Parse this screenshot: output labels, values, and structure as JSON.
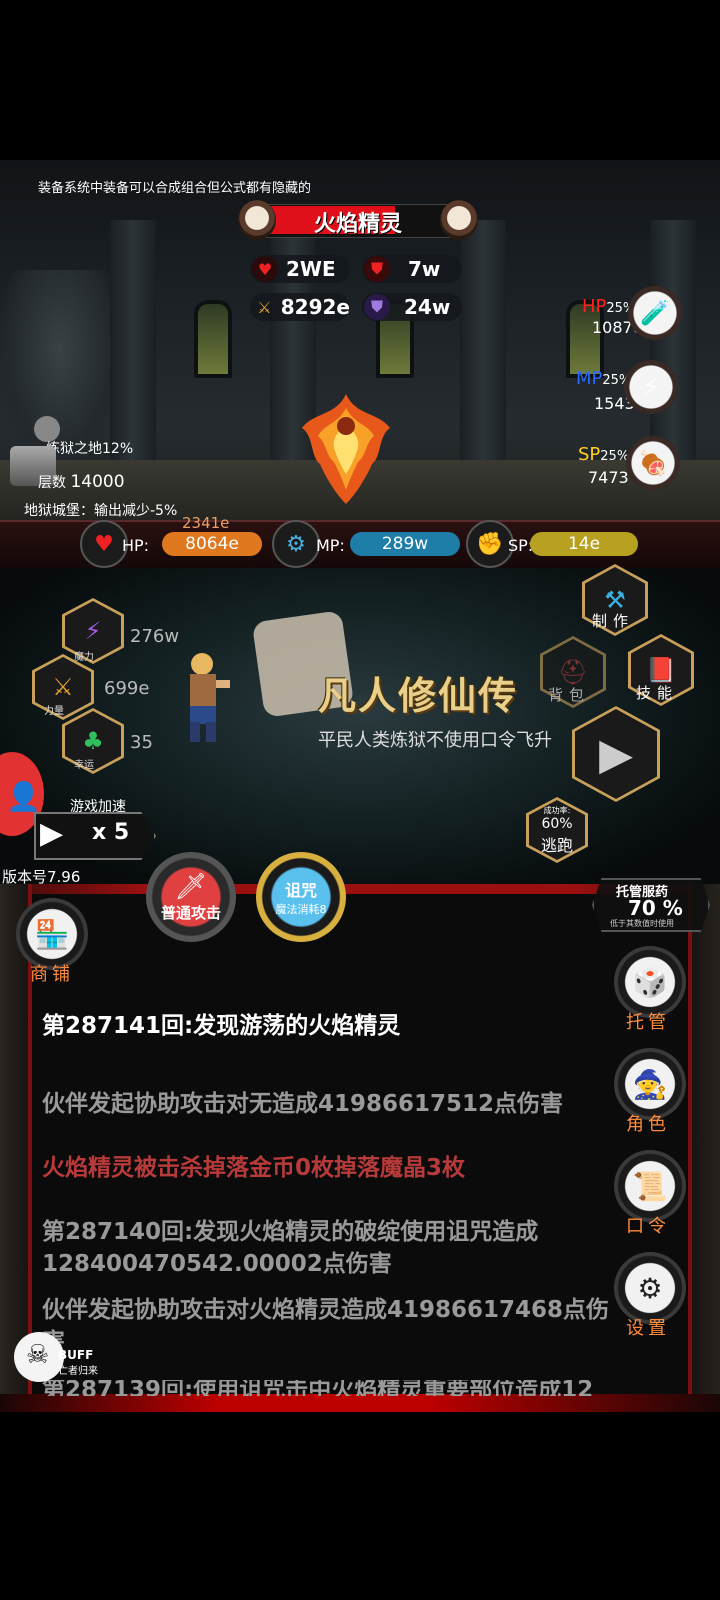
{
  "tip": "装备系统中装备可以合成组合但公式都有隐藏的",
  "enemy": {
    "name": "火焰精灵",
    "hp_fill_ratio": 0.7,
    "stats": {
      "hp": "2WE",
      "def": "7w",
      "atk": "8292e",
      "mdef": "24w"
    }
  },
  "potions": {
    "hp": {
      "label": "HP",
      "pct": "25%",
      "value": "10870"
    },
    "mp": {
      "label": "MP",
      "pct": "25%",
      "value": "1543"
    },
    "sp": {
      "label": "SP",
      "pct": "25%",
      "value": "7473"
    }
  },
  "dungeon": {
    "name": "炼狱之地12%",
    "floor_label": "层数",
    "floor_value": "14000",
    "debuff": "地狱城堡：输出减少-5%"
  },
  "player_bars": {
    "hp_label": "HP:",
    "hp_value": "8064e",
    "hp_regen": "2341e",
    "mp_label": "MP:",
    "mp_value": "289w",
    "sp_label": "SP:",
    "sp_value": "14e"
  },
  "attributes": [
    {
      "label": "魔力",
      "value": "276w"
    },
    {
      "label": "力量",
      "value": "699e"
    },
    {
      "label": "幸运",
      "value": "35"
    }
  ],
  "right_menu": {
    "craft": "制作",
    "bag": "背包",
    "skill": "技能"
  },
  "logo": {
    "title": "凡人修仙传",
    "subtitle": "平民人类炼狱不使用口令飞升"
  },
  "speed": {
    "label": "游戏加速",
    "value": "x 5"
  },
  "escape": {
    "rate_label": "成功率:",
    "rate": "60%",
    "label": "逃跑"
  },
  "version": "版本号7.96",
  "attacks": {
    "normal": "普通攻击",
    "curse": "诅咒",
    "curse_cost": "魔法消耗8"
  },
  "auto_potion": {
    "title": "托管服药",
    "pct": "70 %",
    "note": "低于其数值时使用"
  },
  "shop": "商铺",
  "side_buttons": {
    "auto": "托管",
    "role": "角色",
    "code": "口令",
    "settings": "设置"
  },
  "buff": {
    "label": "BUFF",
    "name": "亡者归来"
  },
  "log": [
    {
      "text": "第287141回:发现游荡的火焰精灵",
      "color": "#ffffff"
    },
    {
      "text": "伙伴发起协助攻击对无造成41986617512点伤害",
      "color": "#9a9a9a"
    },
    {
      "text": "火焰精灵被击杀掉落金币0枚掉落魔晶3枚",
      "color": "#b83a3a"
    },
    {
      "text": "第287140回:发现火焰精灵的破绽使用诅咒造成128400470542.00002点伤害",
      "color": "#9a9a9a"
    },
    {
      "text": "伙伴发起协助攻击对火焰精灵造成41986617468点伤害",
      "color": "#9a9a9a"
    },
    {
      "text": "第287139回:使用诅咒击中火焰精灵重要部位造成12",
      "color": "#9a9a9a"
    }
  ],
  "colors": {
    "hp_bar": "#e07820",
    "mp_bar": "#1e7ea8",
    "sp_bar": "#b8a020",
    "accent_orange": "#ff8a3a",
    "log_red": "#b83a3a"
  }
}
